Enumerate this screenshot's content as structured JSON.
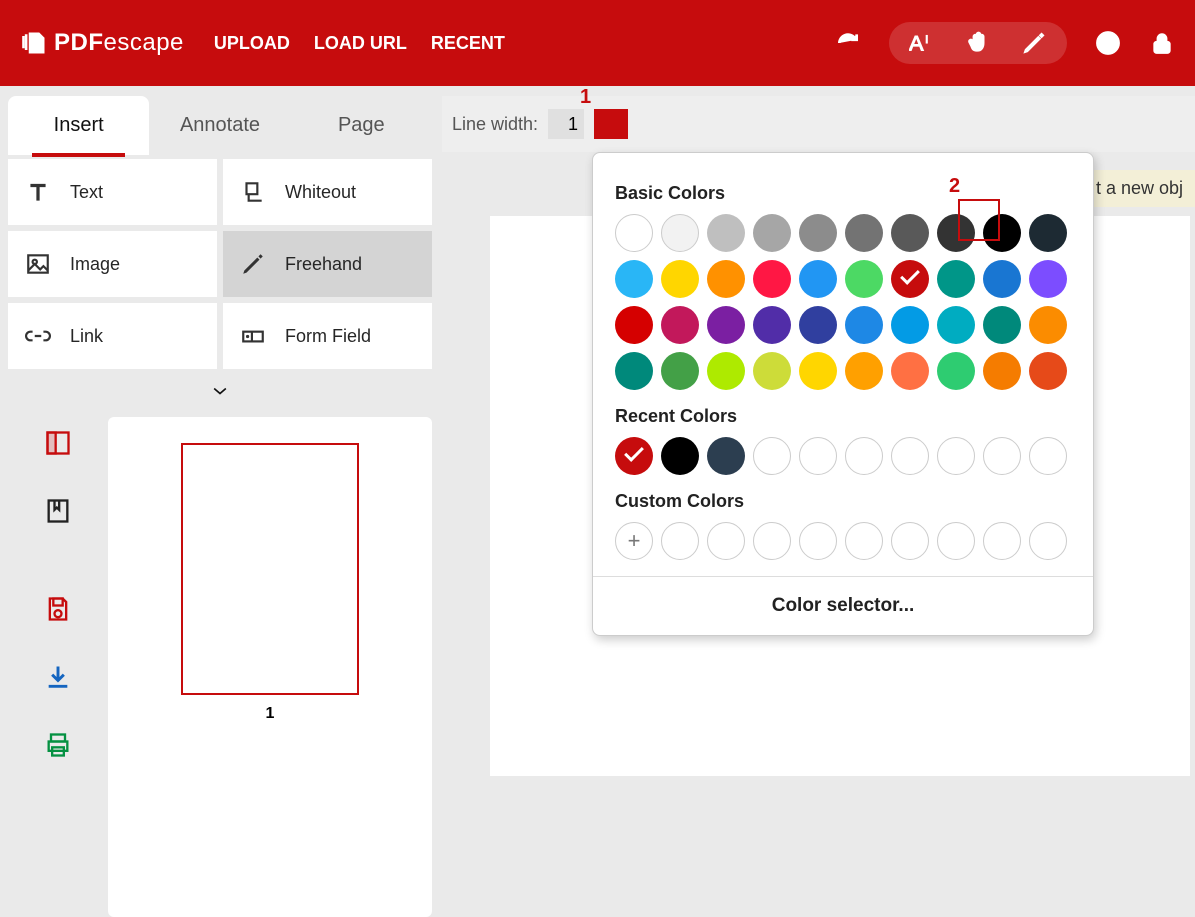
{
  "brand": {
    "name_bold": "PDF",
    "name_light": "escape"
  },
  "header": {
    "nav": [
      "UPLOAD",
      "LOAD URL",
      "RECENT"
    ]
  },
  "tabs": {
    "insert": "Insert",
    "annotate": "Annotate",
    "page": "Page"
  },
  "tools": {
    "text": "Text",
    "whiteout": "Whiteout",
    "image": "Image",
    "freehand": "Freehand",
    "link": "Link",
    "form": "Form Field"
  },
  "prop": {
    "label": "Line width:",
    "value": "1"
  },
  "hint": "t a new obj",
  "thumb": {
    "page_number": "1"
  },
  "markers": {
    "one": "1",
    "two": "2"
  },
  "colorpicker": {
    "basic_label": "Basic Colors",
    "recent_label": "Recent Colors",
    "custom_label": "Custom Colors",
    "selector": "Color selector...",
    "basic": [
      [
        "#FFFFFF",
        "b"
      ],
      [
        "#F2F2F2",
        "b"
      ],
      [
        "#BFBFBF",
        ""
      ],
      [
        "#A6A6A6",
        ""
      ],
      [
        "#8C8C8C",
        ""
      ],
      [
        "#737373",
        ""
      ],
      [
        "#595959",
        ""
      ],
      [
        "#333333",
        ""
      ],
      [
        "#000000",
        ""
      ],
      [
        "#1D2A33",
        ""
      ],
      [
        "#29B6F6",
        ""
      ],
      [
        "#FFD600",
        ""
      ],
      [
        "#FF9100",
        ""
      ],
      [
        "#FF1744",
        ""
      ],
      [
        "#2196F3",
        ""
      ],
      [
        "#4CD964",
        ""
      ],
      [
        "#C60C0D",
        "chk"
      ],
      [
        "#009688",
        ""
      ],
      [
        "#1976D2",
        ""
      ],
      [
        "#7C4DFF",
        ""
      ],
      [
        "#D50000",
        ""
      ],
      [
        "#C2185B",
        ""
      ],
      [
        "#7B1FA2",
        ""
      ],
      [
        "#512DA8",
        ""
      ],
      [
        "#303F9F",
        ""
      ],
      [
        "#1E88E5",
        ""
      ],
      [
        "#039BE5",
        ""
      ],
      [
        "#00ACC1",
        ""
      ],
      [
        "#00897B",
        ""
      ],
      [
        "#FB8C00",
        ""
      ],
      [
        "#00897B",
        ""
      ],
      [
        "#43A047",
        ""
      ],
      [
        "#AEEA00",
        ""
      ],
      [
        "#CDDC39",
        ""
      ],
      [
        "#FFD600",
        ""
      ],
      [
        "#FFA000",
        ""
      ],
      [
        "#FF7043",
        ""
      ],
      [
        "#2ECC71",
        ""
      ],
      [
        "#F57C00",
        ""
      ],
      [
        "#E64A19",
        ""
      ]
    ],
    "recent": [
      [
        "#C60C0D",
        "chk"
      ],
      [
        "#000000",
        ""
      ],
      [
        "#2C3E50",
        ""
      ],
      [
        "#FFFFFF",
        "b"
      ],
      [
        "#FFFFFF",
        "b"
      ],
      [
        "#FFFFFF",
        "b"
      ],
      [
        "#FFFFFF",
        "b"
      ],
      [
        "#FFFFFF",
        "b"
      ],
      [
        "#FFFFFF",
        "b"
      ],
      [
        "#FFFFFF",
        "b"
      ]
    ]
  }
}
